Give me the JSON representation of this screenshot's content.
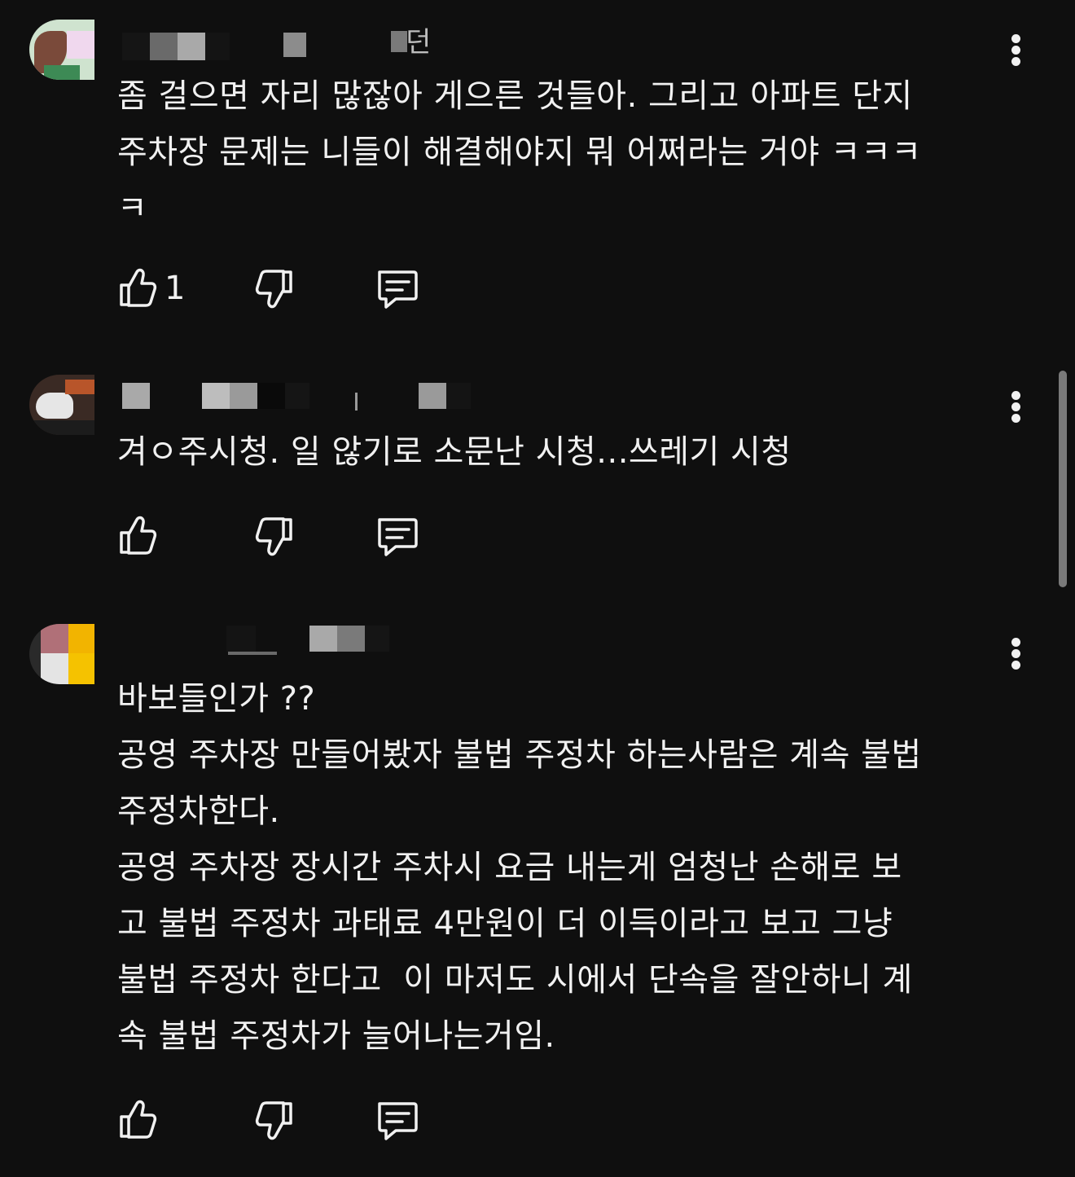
{
  "colors": {
    "background": "#0f0f0f",
    "text": "#f1f1f1",
    "scrollbar": "#7a7a7a"
  },
  "comments": [
    {
      "author_fragment": "던",
      "text": "좀 걸으면 자리 많잖아 게으른 것들아. 그리고 아파트 단지\n주차장 문제는 니들이 해결해야지 뭐 어쩌라는 거야 ㅋㅋㅋ\nㅋ",
      "like_count": "1",
      "icons": [
        "thumb-up-icon",
        "thumb-down-icon",
        "reply-icon",
        "more-vert-icon"
      ]
    },
    {
      "author_fragment": "",
      "text": "겨ㅇ주시청. 일 않기로 소문난 시청...쓰레기 시청",
      "like_count": "",
      "icons": [
        "thumb-up-icon",
        "thumb-down-icon",
        "reply-icon",
        "more-vert-icon"
      ]
    },
    {
      "author_fragment": "",
      "text": "바보들인가 ??\n공영 주차장 만들어봤자 불법 주정차 하는사람은 계속 불법\n주정차한다.\n공영 주차장 장시간 주차시 요금 내는게 엄청난 손해로 보\n고 불법 주정차 과태료 4만원이 더 이득이라고 보고 그냥\n불법 주정차 한다고  이 마저도 시에서 단속을 잘안하니 계\n속 불법 주정차가 늘어나는거임.",
      "like_count": "",
      "icons": [
        "thumb-up-icon",
        "thumb-down-icon",
        "reply-icon",
        "more-vert-icon"
      ]
    }
  ]
}
